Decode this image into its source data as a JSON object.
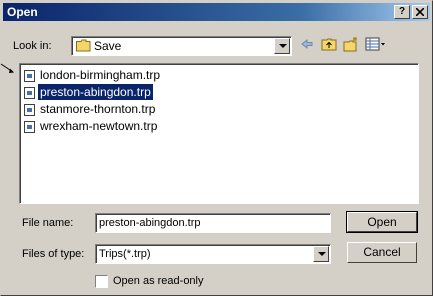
{
  "window": {
    "title": "Open",
    "help_button": "?",
    "close_button": "X"
  },
  "look_in": {
    "label": "Look in:",
    "value": "Save"
  },
  "files": [
    {
      "name": "london-birmingham.trp",
      "selected": false
    },
    {
      "name": "preston-abingdon.trp",
      "selected": true
    },
    {
      "name": "stanmore-thornton.trp",
      "selected": false
    },
    {
      "name": "wrexham-newtown.trp",
      "selected": false
    }
  ],
  "file_name": {
    "label": "File name:",
    "value": "preston-abingdon.trp"
  },
  "file_type": {
    "label": "Files of type:",
    "value": "Trips(*.trp)"
  },
  "buttons": {
    "open": "Open",
    "cancel": "Cancel"
  },
  "read_only": {
    "label": "Open as read-only",
    "checked": false
  },
  "colors": {
    "title_bar": "#0a246a",
    "dialog_bg": "#d4d0c8",
    "selection": "#0a246a"
  },
  "toolbar_icons": [
    "back-arrow-icon",
    "up-folder-icon",
    "new-folder-icon",
    "view-menu-icon"
  ]
}
